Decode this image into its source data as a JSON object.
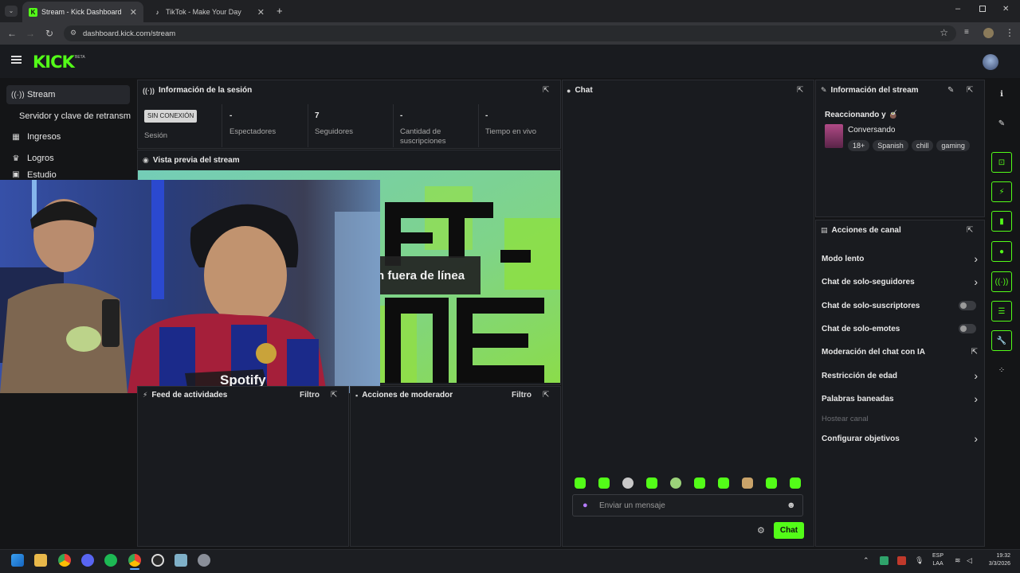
{
  "browser": {
    "tabs": [
      {
        "title": "Stream - Kick Dashboard",
        "favicon": "K"
      },
      {
        "title": "TikTok - Make Your Day",
        "favicon": "♪"
      }
    ],
    "url": "dashboard.kick.com/stream"
  },
  "brand": {
    "logo": "KICK",
    "beta": "BETA",
    "accent": "#53fc18"
  },
  "sidebar": {
    "items": [
      {
        "label": "Stream",
        "icon": "broadcast-icon"
      },
      {
        "label": "Servidor y clave de retransm",
        "icon": ""
      },
      {
        "label": "Ingresos",
        "icon": "wallet-icon"
      },
      {
        "label": "Logros",
        "icon": "trophy-icon"
      },
      {
        "label": "Estudio",
        "icon": "studio-icon"
      }
    ]
  },
  "session": {
    "title": "Información de la sesión",
    "status_badge": "SIN CONEXIÓN",
    "stats": [
      {
        "value": "",
        "label": "Sesión"
      },
      {
        "value": "-",
        "label": "Espectadores"
      },
      {
        "value": "7",
        "label": "Seguidores"
      },
      {
        "value": "-",
        "label": "Cantidad de suscripciones"
      },
      {
        "value": "-",
        "label": "Tiempo en vivo"
      }
    ]
  },
  "preview": {
    "title": "Vista previa del stream",
    "offline_text": "Actualmente fuera de línea",
    "offline_visible": "n fuera de línea"
  },
  "activity": {
    "title": "Feed de actividades",
    "filter": "Filtro"
  },
  "modactions": {
    "title": "Acciones de moderador",
    "filter": "Filtro"
  },
  "chat": {
    "title": "Chat",
    "placeholder": "Enviar un mensaje",
    "send_label": "Chat"
  },
  "stream_info": {
    "title": "Información del stream",
    "stream_title": "Reaccionando y 🧉",
    "category": "Conversando",
    "tags": [
      "18+",
      "Spanish",
      "chill",
      "gaming"
    ]
  },
  "channel_actions": {
    "title": "Acciones de canal",
    "items": [
      {
        "label": "Modo lento",
        "kind": "chevron"
      },
      {
        "label": "Chat de solo-seguidores",
        "kind": "chevron"
      },
      {
        "label": "Chat de solo-suscriptores",
        "kind": "toggle"
      },
      {
        "label": "Chat de solo-emotes",
        "kind": "toggle"
      },
      {
        "label": "Moderación del chat con IA",
        "kind": "external"
      },
      {
        "label": "Restricción de edad",
        "kind": "chevron"
      },
      {
        "label": "Palabras baneadas",
        "kind": "chevron"
      },
      {
        "label": "Hostear canal",
        "kind": "disabled"
      },
      {
        "label": "Configurar objetivos",
        "kind": "chevron"
      }
    ]
  },
  "overlay": {
    "sponsor_text": "Spotify"
  },
  "taskbar": {
    "lang_top": "ESP",
    "lang_bottom": "LAA",
    "time": "19:32",
    "date": "3/3/2026"
  }
}
